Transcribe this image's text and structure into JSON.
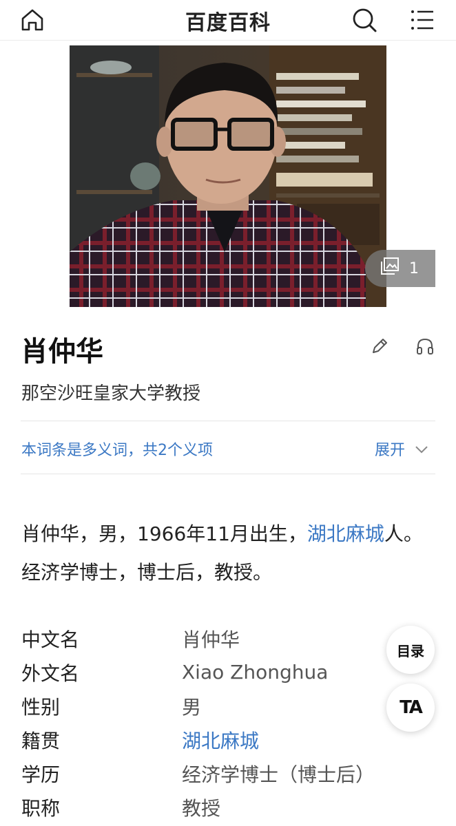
{
  "header": {
    "title": "百度百科"
  },
  "hero": {
    "image_count": "1"
  },
  "entry": {
    "title": "肖仲华",
    "subtitle": "那空沙旺皇家大学教授",
    "polysemy_text": "本词条是多义词，共2个义项",
    "expand_label": "展开"
  },
  "summary": {
    "part1": "肖仲华，男，1966年11月出生，",
    "link": "湖北麻城",
    "part2": "人。经济学博士，博士后，教授。"
  },
  "infobox": [
    {
      "key": "中文名",
      "value": "肖仲华",
      "link": false
    },
    {
      "key": "外文名",
      "value": "Xiao Zhonghua",
      "link": false
    },
    {
      "key": "性别",
      "value": "男",
      "link": false
    },
    {
      "key": "籍贯",
      "value": "湖北麻城",
      "link": true
    },
    {
      "key": "学历",
      "value": "经济学博士（博士后）",
      "link": false
    },
    {
      "key": "职称",
      "value": "教授",
      "link": false
    }
  ],
  "floating": {
    "toc_label": "目录",
    "ta_label": "TA"
  },
  "colors": {
    "link": "#3b78c4",
    "text": "#222222"
  }
}
